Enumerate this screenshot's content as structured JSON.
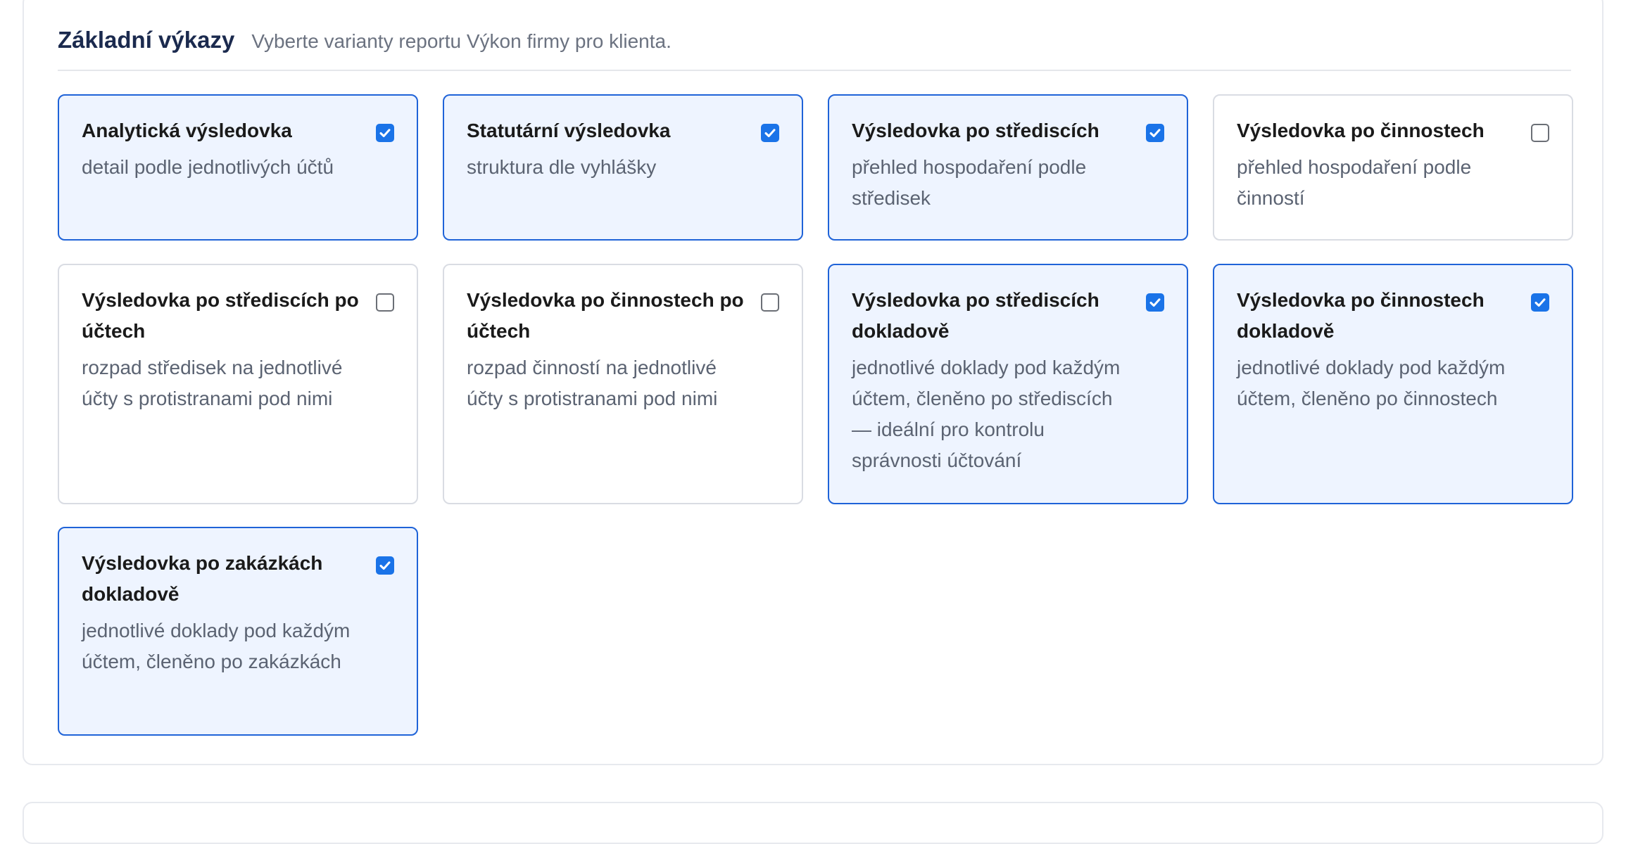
{
  "section": {
    "title": "Základní výkazy",
    "subtitle": "Vyberte varianty reportu Výkon firmy pro klienta."
  },
  "cards": [
    {
      "title": "Analytická výsledovka",
      "description": "detail podle jednotlivých účtů",
      "checked": true
    },
    {
      "title": "Statutární výsledovka",
      "description": "struktura dle vyhlášky",
      "checked": true
    },
    {
      "title": "Výsledovka po střediscích",
      "description": "přehled hospodaření podle středisek",
      "checked": true
    },
    {
      "title": "Výsledovka po činnostech",
      "description": "přehled hospodaření podle činností",
      "checked": false
    },
    {
      "title": "Výsledovka po střediscích po účtech",
      "description": "rozpad středisek na jednotlivé účty s protistranami pod nimi",
      "checked": false
    },
    {
      "title": "Výsledovka po činnostech po účtech",
      "description": "rozpad činností na jednotlivé účty s protistranami pod nimi",
      "checked": false
    },
    {
      "title": "Výsledovka po střediscích dokladově",
      "description": "jednotlivé doklady pod každým účtem, členěno po střediscích — ideální pro kontrolu správnosti účtování",
      "checked": true
    },
    {
      "title": "Výsledovka po činnostech dokladově",
      "description": "jednotlivé doklady pod každým účtem, členěno po činnostech",
      "checked": true
    },
    {
      "title": "Výsledovka po zakázkách dokladově",
      "description": "jednotlivé doklady pod každým účtem, členěno po zakázkách",
      "checked": true
    }
  ],
  "colors": {
    "accent": "#1a73e8",
    "selected_border": "#1f63d8",
    "selected_background": "#eef4ff",
    "title": "#1b2a4e"
  }
}
